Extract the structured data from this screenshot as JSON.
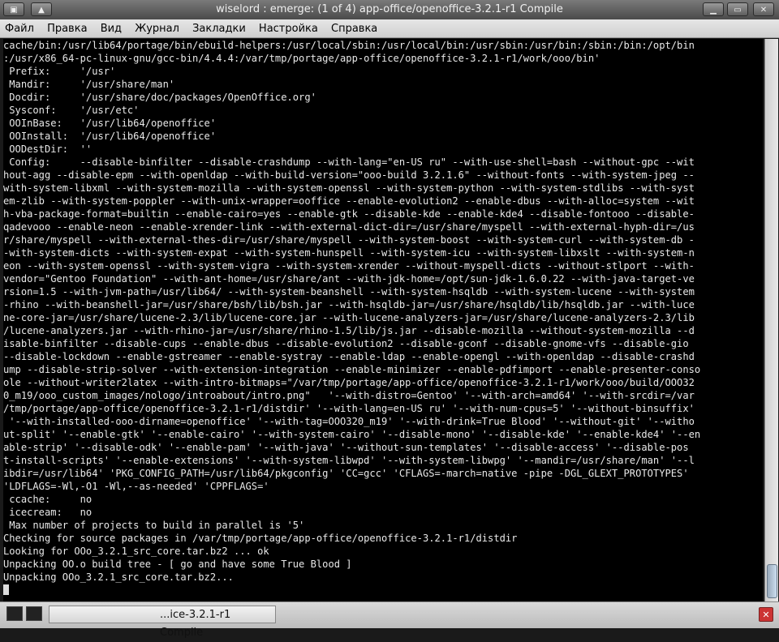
{
  "window": {
    "title": "wiselord : emerge: (1 of 4) app-office/openoffice-3.2.1-r1 Compile",
    "buttons": {
      "menu": "▣",
      "shade": "▲",
      "minimize": "▁",
      "maximize": "▭",
      "close": "✕"
    }
  },
  "menu": [
    "Файл",
    "Правка",
    "Вид",
    "Журнал",
    "Закладки",
    "Настройка",
    "Справка"
  ],
  "terminal": {
    "lines": [
      "cache/bin:/usr/lib64/portage/bin/ebuild-helpers:/usr/local/sbin:/usr/local/bin:/usr/sbin:/usr/bin:/sbin:/bin:/opt/bin",
      ":/usr/x86_64-pc-linux-gnu/gcc-bin/4.4.4:/var/tmp/portage/app-office/openoffice-3.2.1-r1/work/ooo/bin'",
      " Prefix:     '/usr'",
      " Mandir:     '/usr/share/man'",
      " Docdir:     '/usr/share/doc/packages/OpenOffice.org'",
      " Sysconf:    '/usr/etc'",
      " OOInBase:   '/usr/lib64/openoffice'",
      " OOInstall:  '/usr/lib64/openoffice'",
      " OODestDir:  ''",
      " Config:     --disable-binfilter --disable-crashdump --with-lang=\"en-US ru\" --with-use-shell=bash --without-gpc --wit",
      "hout-agg --disable-epm --with-openldap --with-build-version=\"ooo-build 3.2.1.6\" --without-fonts --with-system-jpeg --",
      "with-system-libxml --with-system-mozilla --with-system-openssl --with-system-python --with-system-stdlibs --with-syst",
      "em-zlib --with-system-poppler --with-unix-wrapper=ooffice --enable-evolution2 --enable-dbus --with-alloc=system --wit",
      "h-vba-package-format=builtin --enable-cairo=yes --enable-gtk --disable-kde --enable-kde4 --disable-fontooo --disable-",
      "qadevooo --enable-neon --enable-xrender-link --with-external-dict-dir=/usr/share/myspell --with-external-hyph-dir=/us",
      "r/share/myspell --with-external-thes-dir=/usr/share/myspell --with-system-boost --with-system-curl --with-system-db -",
      "-with-system-dicts --with-system-expat --with-system-hunspell --with-system-icu --with-system-libxslt --with-system-n",
      "eon --with-system-openssl --with-system-vigra --with-system-xrender --without-myspell-dicts --without-stlport --with-",
      "vendor=\"Gentoo Foundation\" --with-ant-home=/usr/share/ant --with-jdk-home=/opt/sun-jdk-1.6.0.22 --with-java-target-ve",
      "rsion=1.5 --with-jvm-path=/usr/lib64/ --with-system-beanshell --with-system-hsqldb --with-system-lucene --with-system",
      "-rhino --with-beanshell-jar=/usr/share/bsh/lib/bsh.jar --with-hsqldb-jar=/usr/share/hsqldb/lib/hsqldb.jar --with-luce",
      "ne-core-jar=/usr/share/lucene-2.3/lib/lucene-core.jar --with-lucene-analyzers-jar=/usr/share/lucene-analyzers-2.3/lib",
      "/lucene-analyzers.jar --with-rhino-jar=/usr/share/rhino-1.5/lib/js.jar --disable-mozilla --without-system-mozilla --d",
      "isable-binfilter --disable-cups --enable-dbus --disable-evolution2 --disable-gconf --disable-gnome-vfs --disable-gio ",
      "--disable-lockdown --enable-gstreamer --enable-systray --enable-ldap --enable-opengl --with-openldap --disable-crashd",
      "ump --disable-strip-solver --with-extension-integration --enable-minimizer --enable-pdfimport --enable-presenter-conso",
      "ole --without-writer2latex --with-intro-bitmaps=\"/var/tmp/portage/app-office/openoffice-3.2.1-r1/work/ooo/build/OOO32",
      "0_m19/ooo_custom_images/nologo/introabout/intro.png\"   '--with-distro=Gentoo' '--with-arch=amd64' '--with-srcdir=/var",
      "/tmp/portage/app-office/openoffice-3.2.1-r1/distdir' '--with-lang=en-US ru' '--with-num-cpus=5' '--without-binsuffix'",
      " '--with-installed-ooo-dirname=openoffice' '--with-tag=OOO320_m19' '--with-drink=True Blood' '--without-git' '--witho",
      "ut-split' '--enable-gtk' '--enable-cairo' '--with-system-cairo' '--disable-mono' '--disable-kde' '--enable-kde4' '--en",
      "able-strip' '--disable-odk' '--enable-pam' '--with-java' '--without-sun-templates' '--disable-access' '--disable-pos",
      "t-install-scripts' '--enable-extensions' '--with-system-libwpd' '--with-system-libwpg' '--mandir=/usr/share/man' '--l",
      "ibdir=/usr/lib64' 'PKG_CONFIG_PATH=/usr/lib64/pkgconfig' 'CC=gcc' 'CFLAGS=-march=native -pipe -DGL_GLEXT_PROTOTYPES'",
      "'LDFLAGS=-Wl,-O1 -Wl,--as-needed' 'CPPFLAGS='",
      " ccache:     no",
      " icecream:   no",
      " Max number of projects to build in parallel is '5'",
      "Checking for source packages in /var/tmp/portage/app-office/openoffice-3.2.1-r1/distdir",
      "Looking for OOo_3.2.1_src_core.tar.bz2 ... ok",
      "Unpacking OO.o build tree - [ go and have some True Blood ]",
      "Unpacking OOo_3.2.1_src_core.tar.bz2..."
    ]
  },
  "taskbar": {
    "task_label": "...ice-3.2.1-r1 Compile",
    "close_glyph": "✕"
  }
}
